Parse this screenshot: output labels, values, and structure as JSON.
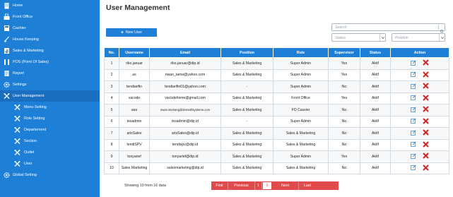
{
  "sidebar": {
    "items": [
      {
        "label": "Home",
        "icon": "building-icon",
        "sub": false
      },
      {
        "label": "Front Office",
        "icon": "front-office-icon",
        "sub": false
      },
      {
        "label": "Cashier",
        "icon": "cashier-icon",
        "sub": false
      },
      {
        "label": "House Keeping",
        "icon": "broom-icon",
        "sub": false
      },
      {
        "label": "Sales & Marketing",
        "icon": "sales-icon",
        "sub": false
      },
      {
        "label": "POS (Point Of Sales)",
        "icon": "pos-icon",
        "sub": false
      },
      {
        "label": "Report",
        "icon": "report-icon",
        "sub": false
      },
      {
        "label": "Settings",
        "icon": "gear-icon",
        "sub": false
      },
      {
        "label": "User Management",
        "icon": "user-management-icon",
        "sub": false
      },
      {
        "label": "Menu Setting",
        "icon": "tools-icon",
        "sub": true
      },
      {
        "label": "Role Setting",
        "icon": "tools-icon",
        "sub": true
      },
      {
        "label": "Departement",
        "icon": "tools-icon",
        "sub": true
      },
      {
        "label": "Section",
        "icon": "tools-icon",
        "sub": true
      },
      {
        "label": "Outlet",
        "icon": "tools-icon",
        "sub": true
      },
      {
        "label": "User",
        "icon": "tools-icon",
        "sub": true
      },
      {
        "label": "Global Setting",
        "icon": "gear-icon",
        "sub": false
      }
    ]
  },
  "page": {
    "title": "User Management",
    "add_button_label": "New User"
  },
  "filters": {
    "search_placeholder": "Search",
    "status_placeholder": "Status",
    "position_placeholder": "Position"
  },
  "table": {
    "columns": [
      "No.",
      "Username",
      "Email",
      "Position",
      "Role",
      "Supervisor",
      "Status",
      "Action"
    ],
    "rows": [
      [
        "1",
        "riko.januar",
        "riko.januar@dip.id",
        "Sales & Marketing",
        "Super Admin",
        "Yes",
        "Aktif"
      ],
      [
        "2",
        "as",
        "riwan_tama@yahoo.com",
        "Sales & Marketing",
        "Super Admin",
        "Yes",
        "Aktif"
      ],
      [
        "3",
        "tendiarifin",
        "tendiarifin01@yahoo.com",
        "-",
        "Super Admin",
        "No",
        "Aktif"
      ],
      [
        "4",
        "vacode",
        "vacodehome@gmail.com",
        "Sales & Marketing",
        "Front Office",
        "Yes",
        "Aktif"
      ],
      [
        "5",
        "asa",
        "riwan.sitohang@sinesoftsystems.com",
        "Sales & Marketing",
        "FO Cassier",
        "No",
        "Aktif"
      ],
      [
        "6",
        "tesadmin",
        "tesadmin@dip.id",
        "-",
        "Super Admin",
        "No",
        "Aktif"
      ],
      [
        "7",
        "arisSales",
        "arisSales@dip.id",
        "Sales & Marketing",
        "Sales & Marketing",
        "No",
        "Aktif"
      ],
      [
        "8",
        "tendiSPV",
        "tendispv@dip.id",
        "Sales & Marketing",
        "Sales & Marketing",
        "No",
        "Aktif"
      ],
      [
        "9",
        "tonyarief",
        "tonyarief@dip.id",
        "Sales & Marketing",
        "Super Admin",
        "Yes",
        "Aktif"
      ],
      [
        "10",
        "Sales Marketing",
        "salesmarketing@dip.id",
        "Sales & Marketing",
        "Sales & Marketing",
        "No",
        "Aktif"
      ]
    ]
  },
  "footer": {
    "showing_text": "Showing 10 from 16 data",
    "pager": {
      "first": "First",
      "previous": "Previous",
      "page1": "1",
      "page2": "2",
      "next": "Next",
      "last": "Last"
    }
  },
  "colors": {
    "accent": "#1e7fd6",
    "delete": "#e02020",
    "pager": "#e24b4b"
  }
}
